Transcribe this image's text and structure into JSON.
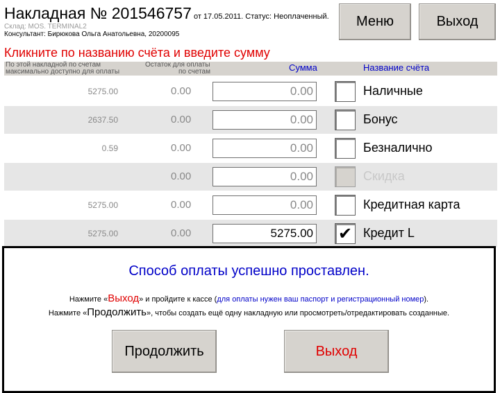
{
  "header": {
    "title": "Накладная № 201546757",
    "date_status": " от 17.05.2011. Статус: Неоплаченный.",
    "warehouse": "Склад: MOS. TERMINAL2",
    "consultant": "Консультант: Бирюкова Ольга Анатольевна, 20200095"
  },
  "buttons": {
    "menu": "Меню",
    "exit": "Выход"
  },
  "instruction": "Кликните по названию счёта и введите сумму",
  "table": {
    "headers": {
      "available_line1": "По этой накладной по счетам",
      "available_line2": "максимально доступно для оплаты",
      "remainder_line1": "Остаток для оплаты",
      "remainder_line2": "по счетам",
      "sum": "Сумма",
      "account": "Название счёта"
    },
    "rows": [
      {
        "available": "5275.00",
        "remainder": "0.00",
        "sum": "0.00",
        "checked": "",
        "account": "Наличные",
        "disabled": false
      },
      {
        "available": "2637.50",
        "remainder": "0.00",
        "sum": "0.00",
        "checked": "",
        "account": "Бонус",
        "disabled": false
      },
      {
        "available": "0.59",
        "remainder": "0.00",
        "sum": "0.00",
        "checked": "",
        "account": "Безналично",
        "disabled": false
      },
      {
        "available": "",
        "remainder": "0.00",
        "sum": "0.00",
        "checked": "",
        "account": "Скидка",
        "disabled": true
      },
      {
        "available": "5275.00",
        "remainder": "0.00",
        "sum": "0.00",
        "checked": "",
        "account": "Кредитная карта",
        "disabled": false
      },
      {
        "available": "5275.00",
        "remainder": "0.00",
        "sum": "5275.00",
        "checked": "✔",
        "account": "Кредит L",
        "disabled": false
      }
    ]
  },
  "dialog": {
    "message": "Способ оплаты успешно проставлен.",
    "line1_a": "Нажмите «",
    "line1_exit": "Выход",
    "line1_b": "» и пройдите к кассе (",
    "line1_blue": "для оплаты нужен ваш паспорт и регистрационный номер",
    "line1_c": ").",
    "line2_a": "Нажмите «",
    "line2_continue": "Продолжить",
    "line2_b": "», чтобы создать ещё одну накладную или просмотреть/отредактировать созданные.",
    "continue_button": "Продолжить",
    "exit_button": "Выход"
  },
  "colors": {
    "accent_blue": "#0000c8",
    "alert_red": "#e00000",
    "button_gray": "#d6d3ce"
  }
}
